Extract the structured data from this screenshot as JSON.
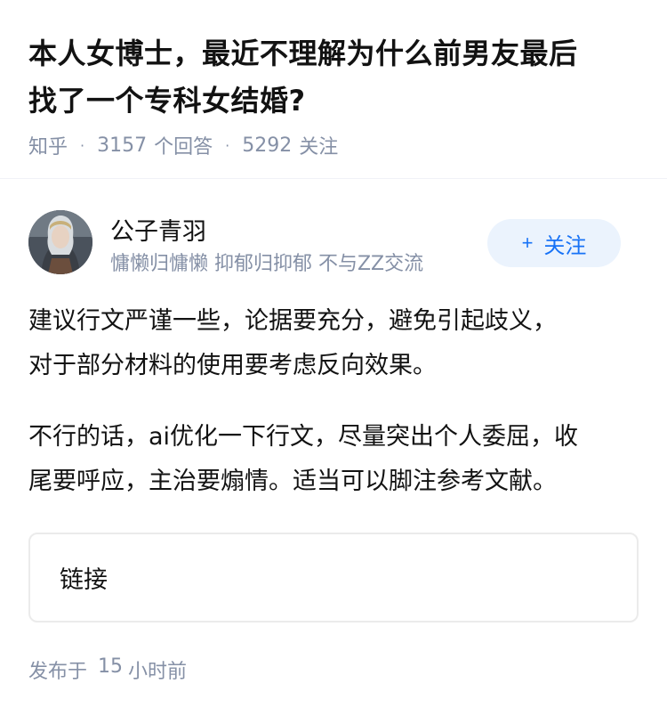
{
  "question": {
    "title_line1": "本人女博士，最近不理解为什么前男友最后",
    "title_line2": "找了一个专科女结婚?",
    "source": "知乎",
    "answers_count": "3157",
    "answers_label": "个回答",
    "followers_count": "5292",
    "followers_label": "关注"
  },
  "author": {
    "name": "公子青羽",
    "bio": "慵懒归慵懒 抑郁归抑郁 不与ZZ交流",
    "follow_label": "关注"
  },
  "answer": {
    "paragraph1_line1": "建议行文严谨一些，论据要充分，避免引起歧义，",
    "paragraph1_line2": "对于部分材料的使用要考虑反向效果。",
    "paragraph2_line1": "不行的话，ai优化一下行文，尽量突出个人委屈，收",
    "paragraph2_line2": "尾要呼应，主治要煽情。适当可以脚注参考文献。",
    "link_label": "链接"
  },
  "publish": {
    "prefix": "发布于",
    "count": "15",
    "suffix": "小时前"
  },
  "colors": {
    "accent": "#1772f6",
    "accent_bg": "#ebf3fd",
    "meta_gray": "#8590a6",
    "text": "#121212"
  }
}
